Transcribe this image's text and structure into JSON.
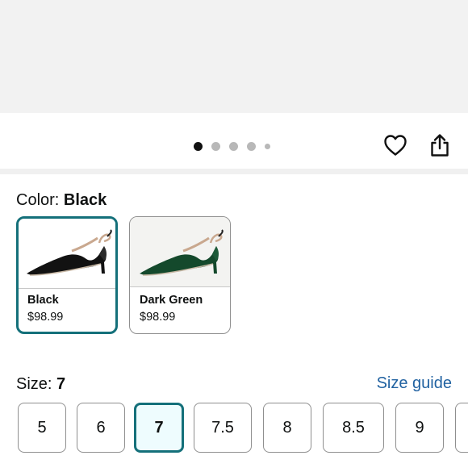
{
  "carousel": {
    "dots": [
      {
        "active": true,
        "size": "lg"
      },
      {
        "active": false,
        "size": "lg"
      },
      {
        "active": false,
        "size": "lg"
      },
      {
        "active": false,
        "size": "lg"
      },
      {
        "active": false,
        "size": "sm"
      }
    ]
  },
  "actions": {
    "wishlist_icon": "heart-outline-icon",
    "share_icon": "share-icon"
  },
  "color": {
    "label": "Color:",
    "selected": "Black",
    "options": [
      {
        "name": "Black",
        "price": "$98.99",
        "selected": true,
        "shoe_color": "#121212"
      },
      {
        "name": "Dark Green",
        "price": "$98.99",
        "selected": false,
        "shoe_color": "#14492c"
      }
    ]
  },
  "size": {
    "label": "Size:",
    "selected": "7",
    "guide_link": "Size guide",
    "options": [
      {
        "label": "5",
        "selected": false
      },
      {
        "label": "6",
        "selected": false
      },
      {
        "label": "7",
        "selected": true
      },
      {
        "label": "7.5",
        "selected": false
      },
      {
        "label": "8",
        "selected": false
      },
      {
        "label": "8.5",
        "selected": false
      },
      {
        "label": "9",
        "selected": false
      }
    ]
  },
  "colors": {
    "accent": "#14707a",
    "link": "#2162a1",
    "selected_bg": "#eefcfe"
  }
}
